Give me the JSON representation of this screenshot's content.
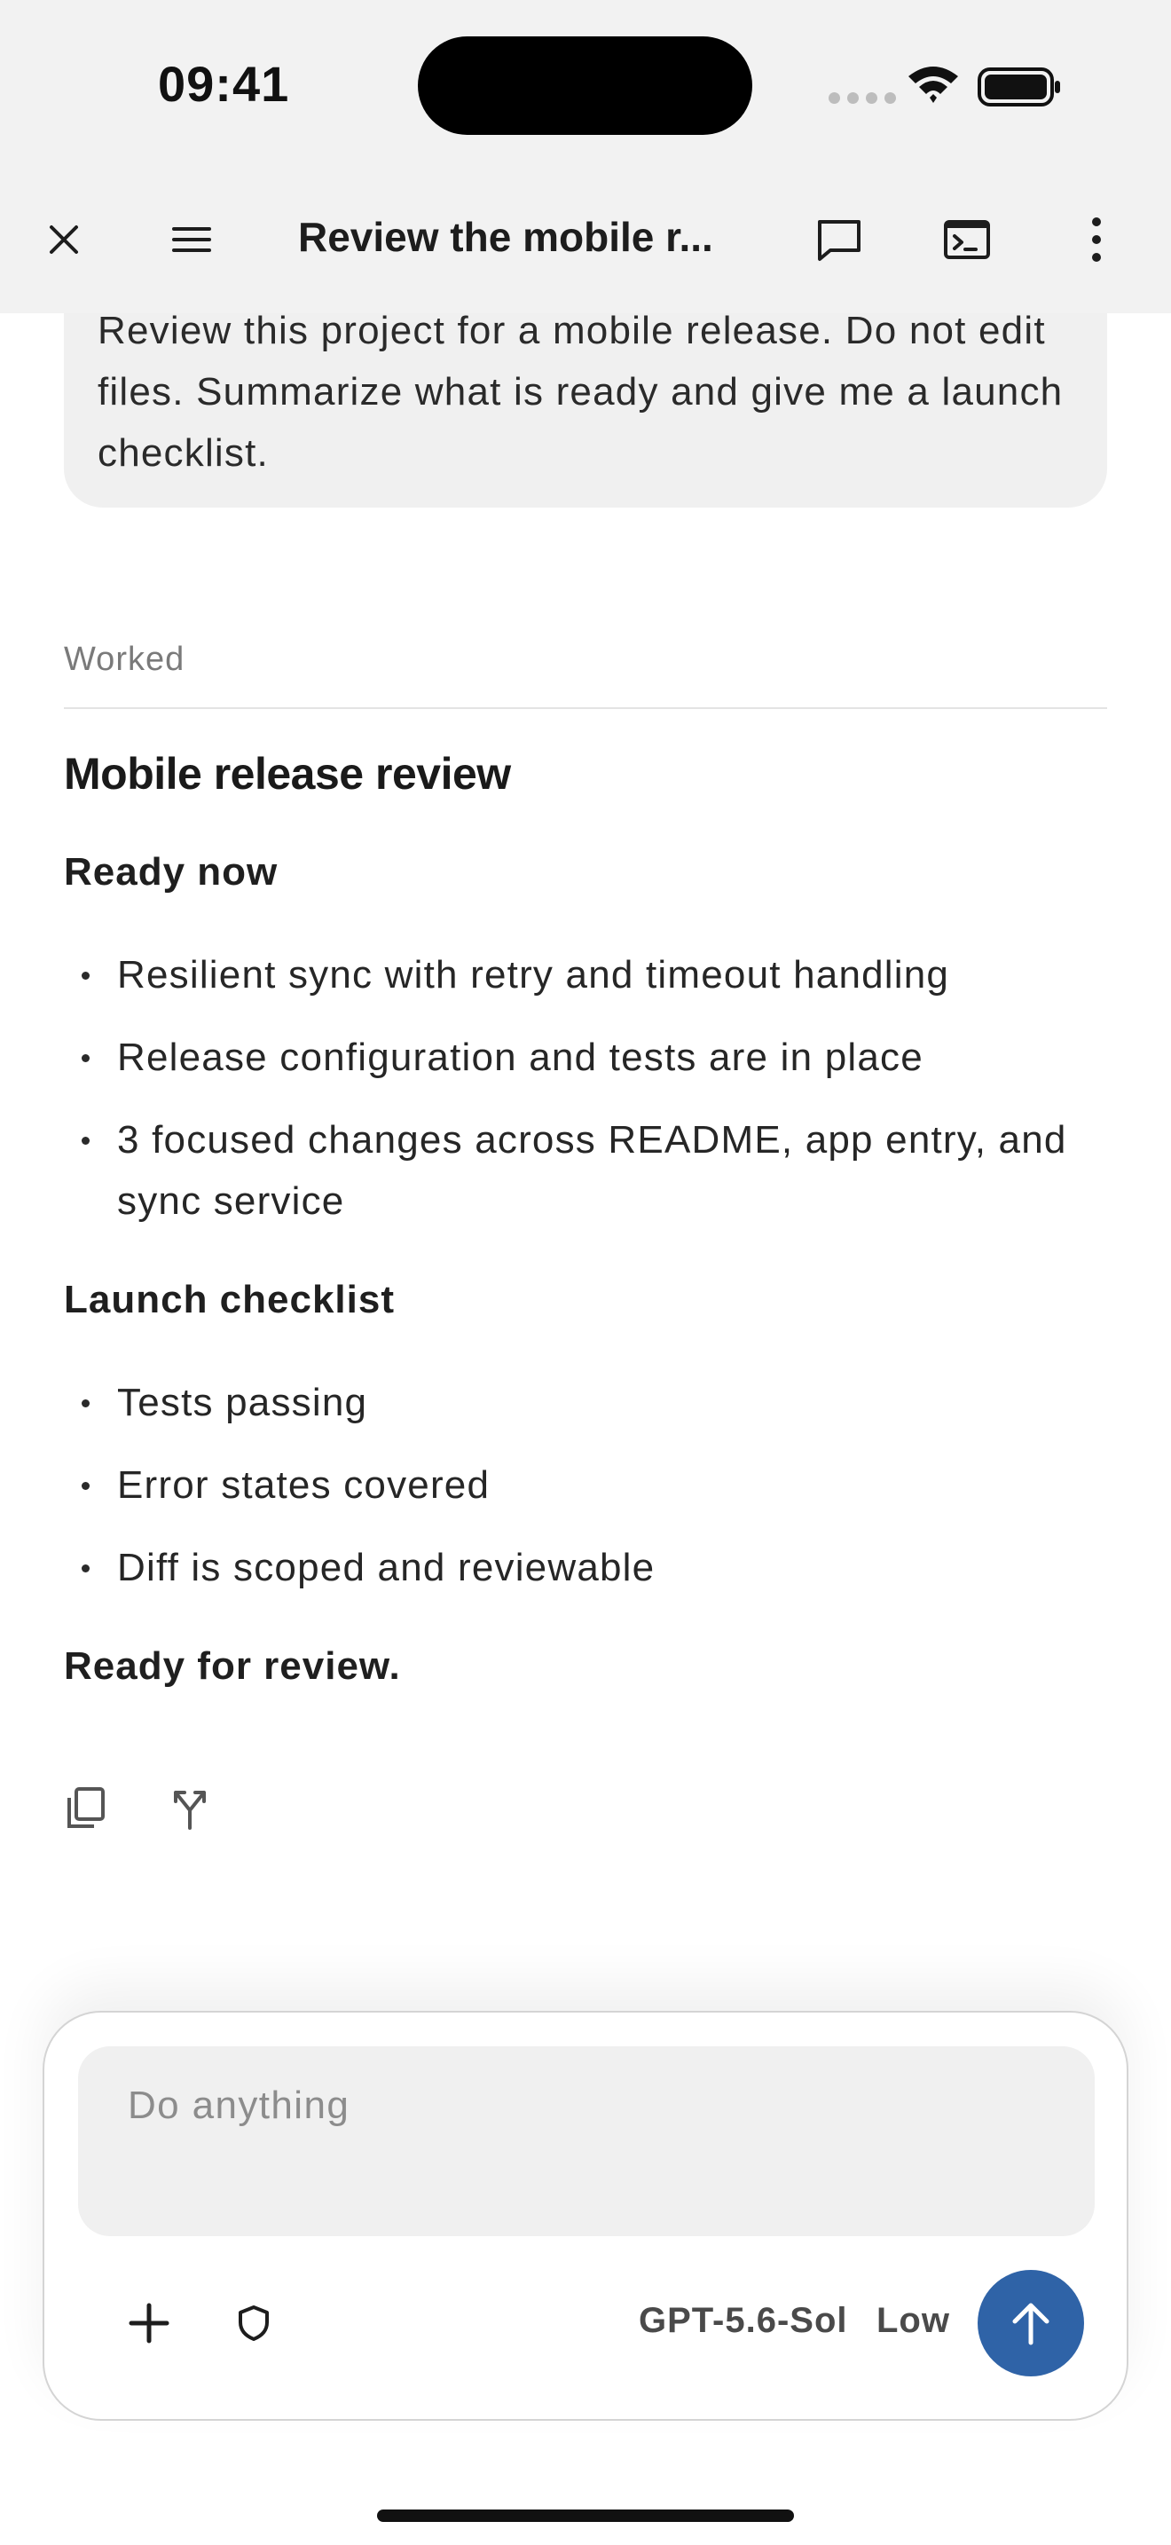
{
  "status_bar": {
    "time": "09:41"
  },
  "header": {
    "title": "Review the mobile r...",
    "icons": [
      "close-icon",
      "menu-icon",
      "chat-icon",
      "terminal-icon",
      "more-vertical-icon"
    ]
  },
  "conversation": {
    "user_message": "Review this project for a mobile release. Do not edit files. Summarize what is ready and give me a launch checklist.",
    "status_label": "Worked",
    "response": {
      "heading": "Mobile release review",
      "section1_title": "Ready now",
      "section1_items": [
        "Resilient sync with retry and timeout handling",
        "Release configuration and tests are in place",
        "3 focused changes across README, app entry, and sync service"
      ],
      "section2_title": "Launch checklist",
      "section2_items": [
        "Tests passing",
        "Error states covered",
        "Diff is scoped and reviewable"
      ],
      "closing": "Ready for review."
    },
    "action_icons": [
      "copy-icon",
      "fork-icon"
    ]
  },
  "composer": {
    "placeholder": "Do anything",
    "model": "GPT-5.6-Sol",
    "effort": "Low",
    "accent_color": "#2f63a7"
  }
}
